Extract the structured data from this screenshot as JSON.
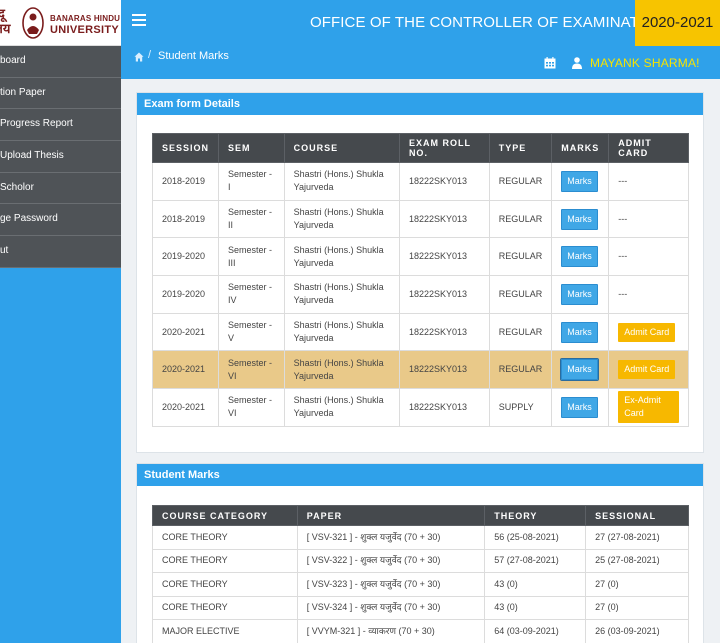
{
  "logo": {
    "script_text_top": "न्दू",
    "script_text_bottom": "लय",
    "name_line1": "BANARAS HINDU",
    "name_line2": "UNIVERSITY"
  },
  "sidebar": {
    "items": [
      {
        "label": "board"
      },
      {
        "label": "tion Paper"
      },
      {
        "label": "Progress Report"
      },
      {
        "label": "Upload Thesis"
      },
      {
        "label": "Scholor"
      },
      {
        "label": "ge Password"
      },
      {
        "label": "ut"
      }
    ]
  },
  "header": {
    "title": "OFFICE OF THE CONTROLLER OF EXAMINATIONS",
    "session": "2020-2021"
  },
  "breadcrumb": {
    "separator": "/",
    "current": "Student Marks"
  },
  "user": {
    "name": "MAYANK SHARMA!"
  },
  "exam_details": {
    "title": "Exam form Details",
    "headers": [
      "SESSION",
      "SEM",
      "COURSE",
      "EXAM ROLL NO.",
      "TYPE",
      "MARKS",
      "ADMIT CARD"
    ],
    "rows": [
      {
        "session": "2018-2019",
        "sem": "Semester - I",
        "course": "Shastri (Hons.) Shukla Yajurveda",
        "roll": "18222SKY013",
        "type": "REGULAR",
        "marks": "Marks",
        "admit": "---"
      },
      {
        "session": "2018-2019",
        "sem": "Semester - II",
        "course": "Shastri (Hons.) Shukla Yajurveda",
        "roll": "18222SKY013",
        "type": "REGULAR",
        "marks": "Marks",
        "admit": "---"
      },
      {
        "session": "2019-2020",
        "sem": "Semester - III",
        "course": "Shastri (Hons.) Shukla Yajurveda",
        "roll": "18222SKY013",
        "type": "REGULAR",
        "marks": "Marks",
        "admit": "---"
      },
      {
        "session": "2019-2020",
        "sem": "Semester - IV",
        "course": "Shastri (Hons.) Shukla Yajurveda",
        "roll": "18222SKY013",
        "type": "REGULAR",
        "marks": "Marks",
        "admit": "---"
      },
      {
        "session": "2020-2021",
        "sem": "Semester - V",
        "course": "Shastri (Hons.) Shukla Yajurveda",
        "roll": "18222SKY013",
        "type": "REGULAR",
        "marks": "Marks",
        "admit": "Admit Card"
      },
      {
        "session": "2020-2021",
        "sem": "Semester - VI",
        "course": "Shastri (Hons.) Shukla Yajurveda",
        "roll": "18222SKY013",
        "type": "REGULAR",
        "marks": "Marks",
        "admit": "Admit Card"
      },
      {
        "session": "2020-2021",
        "sem": "Semester - VI",
        "course": "Shastri (Hons.) Shukla Yajurveda",
        "roll": "18222SKY013",
        "type": "SUPPLY",
        "marks": "Marks",
        "admit": "Ex-Admit Card"
      }
    ]
  },
  "student_marks": {
    "title": "Student Marks",
    "headers": [
      "COURSE CATEGORY",
      "PAPER",
      "THEORY",
      "SESSIONAL"
    ],
    "rows": [
      {
        "category": "CORE THEORY",
        "paper": "[ VSV-321 ] - शुक्ल यजुर्वेद (70 + 30)",
        "theory": "56 (25-08-2021)",
        "sessional": "27 (27-08-2021)"
      },
      {
        "category": "CORE THEORY",
        "paper": "[ VSV-322 ] - शुक्ल यजुर्वेद (70 + 30)",
        "theory": "57 (27-08-2021)",
        "sessional": "25 (27-08-2021)"
      },
      {
        "category": "CORE THEORY",
        "paper": "[ VSV-323 ] - शुक्ल यजुर्वेद (70 + 30)",
        "theory": "43 (0)",
        "sessional": "27 (0)"
      },
      {
        "category": "CORE THEORY",
        "paper": "[ VSV-324 ] - शुक्ल यजुर्वेद (70 + 30)",
        "theory": "43 (0)",
        "sessional": "27 (0)"
      },
      {
        "category": "MAJOR ELECTIVE",
        "paper": "[ VVYM-321 ] - व्याकरण (70 + 30)",
        "theory": "64 (03-09-2021)",
        "sessional": "26 (03-09-2021)"
      }
    ]
  },
  "colors": {
    "primary": "#2fa1ea",
    "sidebar_item": "#4f5357",
    "session_badge": "#f7c400",
    "user_name": "#f7e300",
    "highlight_row": "#e9c989",
    "admit_button": "#f7b800",
    "marks_button": "#40a7e6"
  },
  "icons": [
    "home-icon",
    "calendar-icon",
    "user-icon",
    "menu-icon"
  ]
}
